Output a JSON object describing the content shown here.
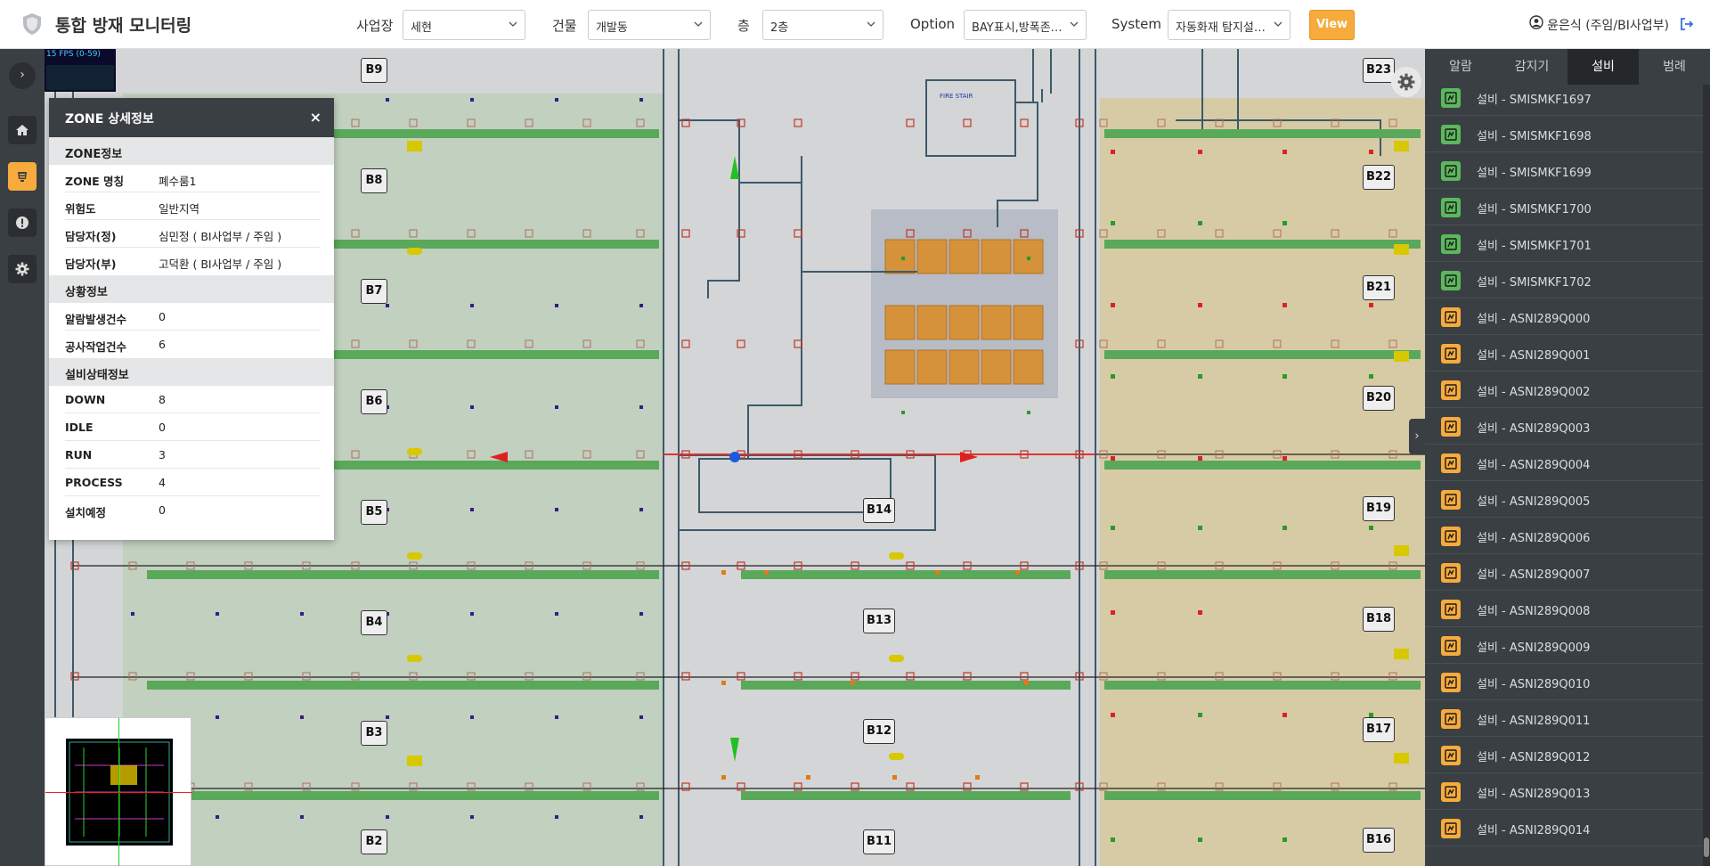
{
  "header": {
    "title": "통합 방재 모니터링",
    "filters": [
      {
        "label": "사업장",
        "value": "세현"
      },
      {
        "label": "건물",
        "value": "개발동"
      },
      {
        "label": "층",
        "value": "2층"
      },
      {
        "label": "Option",
        "value": "BAY표시,방폭존…"
      },
      {
        "label": "System",
        "value": "자동화재 탐지설…"
      }
    ],
    "view_label": "View",
    "user": "윤은식 (주임/BI사업부)"
  },
  "map": {
    "fps": "15 FPS (0-59)",
    "bays": [
      "B9",
      "B8",
      "B7",
      "B6",
      "B5",
      "B4",
      "B3",
      "B2",
      "B22",
      "B21",
      "B20",
      "B19",
      "B18",
      "B17",
      "B16",
      "B14",
      "B13",
      "B12",
      "B11",
      "B23"
    ],
    "fire_stair": "FIRE STAIR"
  },
  "zone": {
    "title": "ZONE 상세정보",
    "close": "×",
    "sections": [
      {
        "title": "ZONE정보",
        "rows": [
          {
            "k": "ZONE 명칭",
            "v": "폐수룸1"
          },
          {
            "k": "위험도",
            "v": "일반지역"
          },
          {
            "k": "담당자(정)",
            "v": "심민정 ( BI사업부 / 주임 )"
          },
          {
            "k": "담당자(부)",
            "v": "고덕환 ( BI사업부 / 주임 )"
          }
        ]
      },
      {
        "title": "상황정보",
        "rows": [
          {
            "k": "알람발생건수",
            "v": "0"
          },
          {
            "k": "공사작업건수",
            "v": "6"
          }
        ]
      },
      {
        "title": "설비상태정보",
        "rows": [
          {
            "k": "DOWN",
            "v": "8"
          },
          {
            "k": "IDLE",
            "v": "0"
          },
          {
            "k": "RUN",
            "v": "3"
          },
          {
            "k": "PROCESS",
            "v": "4"
          },
          {
            "k": "설치예정",
            "v": "0"
          }
        ]
      }
    ]
  },
  "right_panel": {
    "tabs": [
      "알람",
      "감지기",
      "설비",
      "범례"
    ],
    "active_tab": 2,
    "items": [
      {
        "label": "설비 - SMISMKF1697",
        "status": "green"
      },
      {
        "label": "설비 - SMISMKF1698",
        "status": "green"
      },
      {
        "label": "설비 - SMISMKF1699",
        "status": "green"
      },
      {
        "label": "설비 - SMISMKF1700",
        "status": "green"
      },
      {
        "label": "설비 - SMISMKF1701",
        "status": "green"
      },
      {
        "label": "설비 - SMISMKF1702",
        "status": "green"
      },
      {
        "label": "설비 - ASNI289Q000",
        "status": "orange"
      },
      {
        "label": "설비 - ASNI289Q001",
        "status": "orange"
      },
      {
        "label": "설비 - ASNI289Q002",
        "status": "orange"
      },
      {
        "label": "설비 - ASNI289Q003",
        "status": "orange"
      },
      {
        "label": "설비 - ASNI289Q004",
        "status": "orange"
      },
      {
        "label": "설비 - ASNI289Q005",
        "status": "orange"
      },
      {
        "label": "설비 - ASNI289Q006",
        "status": "orange"
      },
      {
        "label": "설비 - ASNI289Q007",
        "status": "orange"
      },
      {
        "label": "설비 - ASNI289Q008",
        "status": "orange"
      },
      {
        "label": "설비 - ASNI289Q009",
        "status": "orange"
      },
      {
        "label": "설비 - ASNI289Q010",
        "status": "orange"
      },
      {
        "label": "설비 - ASNI289Q011",
        "status": "orange"
      },
      {
        "label": "설비 - ASNI289Q012",
        "status": "orange"
      },
      {
        "label": "설비 - ASNI289Q013",
        "status": "orange"
      },
      {
        "label": "설비 - ASNI289Q014",
        "status": "orange"
      }
    ]
  },
  "colors": {
    "accent": "#f7ab3c",
    "dark": "#3a3f44",
    "green": "#5cb85c",
    "orange": "#f7ab3c"
  }
}
